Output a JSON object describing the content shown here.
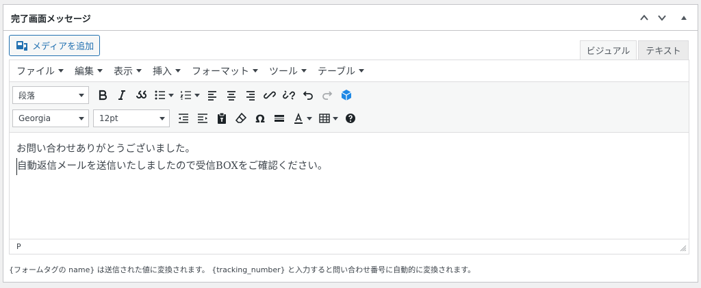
{
  "panel": {
    "title": "完了画面メッセージ",
    "controls": [
      "chevron-up-icon",
      "chevron-down-icon",
      "triangle-up-icon"
    ]
  },
  "media_button": {
    "label": "メディアを追加",
    "icon": "media-icon"
  },
  "tabs": [
    {
      "label": "ビジュアル",
      "active": true
    },
    {
      "label": "テキスト",
      "active": false
    }
  ],
  "menubar": [
    {
      "label": "ファイル"
    },
    {
      "label": "編集"
    },
    {
      "label": "表示"
    },
    {
      "label": "挿入"
    },
    {
      "label": "フォーマット"
    },
    {
      "label": "ツール"
    },
    {
      "label": "テーブル"
    }
  ],
  "toolbar": {
    "format_select": "段落",
    "font_select": "Georgia",
    "size_select": "12pt",
    "icons_row1": [
      "bold-icon",
      "italic-icon",
      "blockquote-icon",
      "bullet-list-icon",
      "numbered-list-icon",
      "align-left-icon",
      "align-center-icon",
      "align-right-icon",
      "link-icon",
      "unlink-icon",
      "undo-icon",
      "redo-icon",
      "plugin-icon"
    ],
    "icons_row2": [
      "outdent-icon",
      "indent-icon",
      "paste-text-icon",
      "clear-format-icon",
      "special-char-icon",
      "horizontal-line-icon",
      "text-color-icon",
      "table-icon",
      "help-icon"
    ]
  },
  "content": {
    "line1": "お問い合わせありがとうございました。",
    "line2": "自動返信メールを送信いたしましたので受信BOXをご確認ください。"
  },
  "statusbar": {
    "path": "P"
  },
  "note": "{フォームタグの name} は送信された値に変換されます。 {tracking_number} と入力すると問い合わせ番号に自動的に変換されます。",
  "colors": {
    "accent": "#2271b1",
    "plugin_icon": "#1e88e5"
  }
}
